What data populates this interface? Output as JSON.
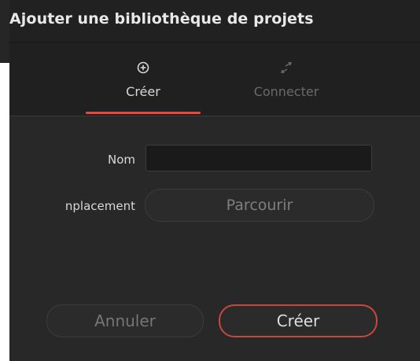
{
  "dialog": {
    "title": "Ajouter une bibliothèque de projets"
  },
  "tabs": [
    {
      "label": "Créer",
      "icon": "plus-circle-icon",
      "active": true
    },
    {
      "label": "Connecter",
      "icon": "connect-arrows-icon",
      "active": false
    }
  ],
  "form": {
    "name_label": "Nom",
    "name_value": "",
    "location_label": "nplacement",
    "browse_label": "Parcourir"
  },
  "footer": {
    "cancel_label": "Annuler",
    "create_label": "Créer"
  },
  "colors": {
    "accent": "#e5483e",
    "background": "#282828",
    "titlebar": "#212121",
    "text": "#e8e8e8",
    "muted_text": "#767676"
  }
}
